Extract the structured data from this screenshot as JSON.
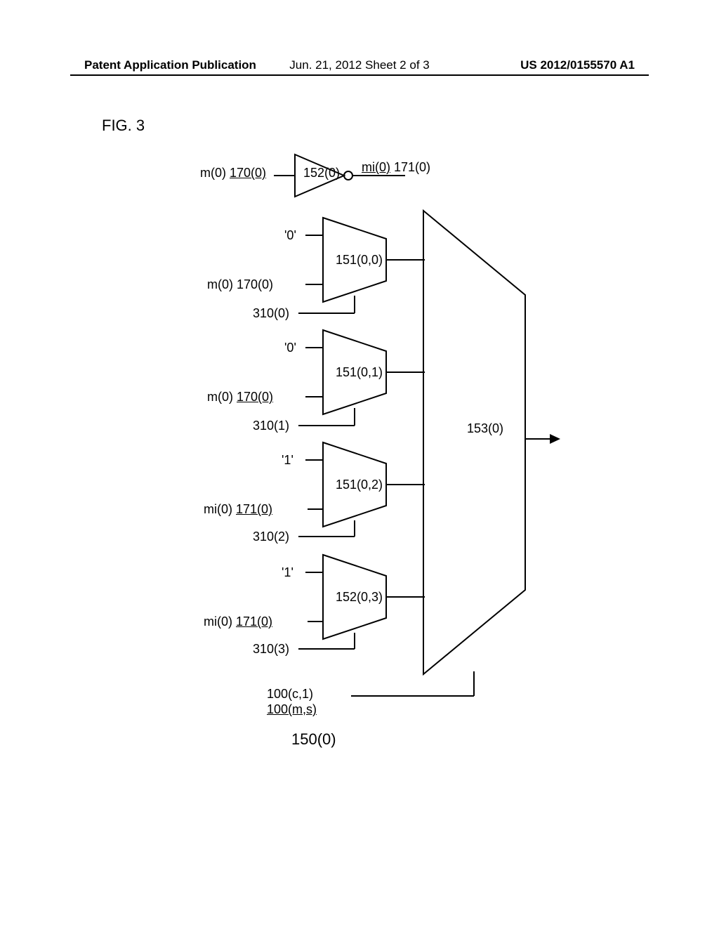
{
  "header": {
    "left": "Patent Application Publication",
    "center": "Jun. 21, 2012  Sheet 2 of 3",
    "right": "US 2012/0155570 A1"
  },
  "figure_label": "FIG. 3",
  "inverter": {
    "input_label": "m(0)",
    "input_ref": "170(0)",
    "block_label": "152(0)",
    "output_label": "mi(0)",
    "output_ref": "171(0)"
  },
  "muxes": [
    {
      "top_input": "'0'",
      "bottom_input_label": "m(0)",
      "bottom_input_ref": "170(0)",
      "select_label": "310(0)",
      "block_label": "151(0,0)"
    },
    {
      "top_input": "'0'",
      "bottom_input_label": "m(0)",
      "bottom_input_ref": "170(0)",
      "select_label": "310(1)",
      "block_label": "151(0,1)"
    },
    {
      "top_input": "'1'",
      "bottom_input_label": "mi(0)",
      "bottom_input_ref": "171(0)",
      "select_label": "310(2)",
      "block_label": "151(0,2)"
    },
    {
      "top_input": "'1'",
      "bottom_input_label": "mi(0)",
      "bottom_input_ref": "171(0)",
      "select_label": "310(3)",
      "block_label": "152(0,3)"
    }
  ],
  "big_trapezoid": {
    "label": "153(0)"
  },
  "bottom_labels": {
    "ref1": "100(c,1)",
    "ref2": "100(m,s)",
    "main": "150(0)"
  }
}
